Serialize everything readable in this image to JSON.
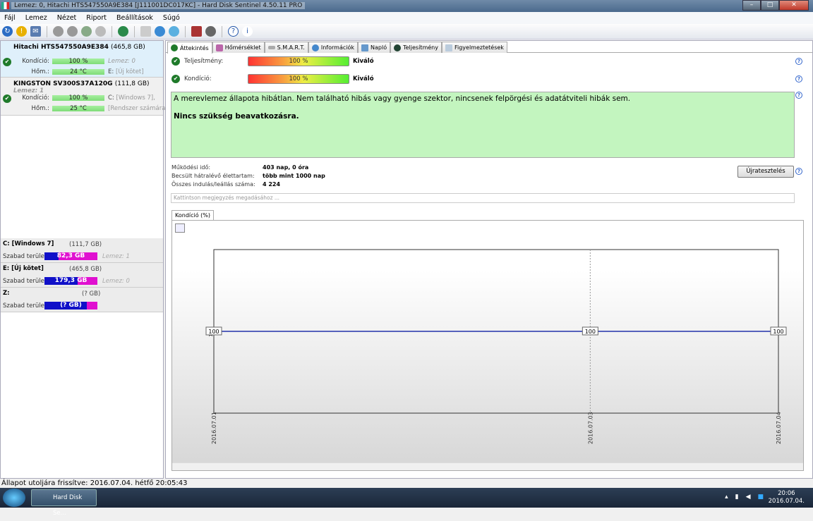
{
  "window": {
    "title": "Lemez: 0, Hitachi HTS547550A9E384 [J111001DC017KC]  -  Hard Disk Sentinel 4.50.11 PRO"
  },
  "menu": [
    "Fájl",
    "Lemez",
    "Nézet",
    "Riport",
    "Beállítások",
    "Súgó"
  ],
  "disks": [
    {
      "name": "Hitachi HTS547550A9E384",
      "size": "(465,8 GB)",
      "cond_label": "Kondíció:",
      "cond": "100 %",
      "temp_label": "Hőm.:",
      "temp": "24 °C",
      "extra1": "Lemez: 0",
      "extra2_drive": "E:",
      "extra2": "[Új kötet]"
    },
    {
      "name": "KINGSTON SV300S37A120G",
      "size": "(111,8 GB)",
      "disk_no": "Lemez: 1",
      "cond_label": "Kondíció:",
      "cond": "100 %",
      "temp_label": "Hőm.:",
      "temp": "25 °C",
      "extra1_drive": "C:",
      "extra1": "[Windows 7],",
      "extra2": "[Rendszer számára"
    }
  ],
  "volumes": [
    {
      "name": "C: [Windows 7]",
      "size": "(111,7 GB)",
      "free_label": "Szabad terület",
      "free": "82,3 GB",
      "used_fraction": 0.26,
      "disk": "Lemez: 1"
    },
    {
      "name": "E: [Új kötet]",
      "size": "(465,8 GB)",
      "free_label": "Szabad terület",
      "free": "179,3 GB",
      "used_fraction": 0.62,
      "disk": "Lemez: 0"
    },
    {
      "name": "Z:",
      "size": "(? GB)",
      "free_label": "Szabad terület",
      "free": "(? GB)",
      "used_fraction": 0.8,
      "disk": ""
    }
  ],
  "tabs": [
    "Áttekintés",
    "Hőmérséklet",
    "S.M.A.R.T.",
    "Információk",
    "Napló",
    "Teljesítmény",
    "Figyelmeztetések"
  ],
  "overview": {
    "perf_label": "Teljesítmény:",
    "perf": "100 %",
    "perf_rating": "Kiváló",
    "cond_label": "Kondíció:",
    "cond": "100 %",
    "cond_rating": "Kiváló",
    "message": "A merevlemez állapota hibátlan. Nem található hibás vagy gyenge szektor, nincsenek felpörgési és adatátviteli hibák sem.",
    "message2": "Nincs szükség beavatkozásra.",
    "uptime_label": "Működési idő:",
    "uptime": "403 nap, 0 óra",
    "life_label": "Becsült hátralévő élettartam:",
    "life": "több mint 1000 nap",
    "starts_label": "Összes indulás/leállás száma:",
    "starts": "4 224",
    "retest": "Újratesztelés",
    "note_placeholder": "Kattintson megjegyzés megadásához ...",
    "chart_tab": "Kondíció  (%)"
  },
  "chart_data": {
    "type": "line",
    "title": "Kondíció (%)",
    "x": [
      "2016.07.01",
      "2016.07.03",
      "2016.07.04"
    ],
    "x_days": [
      0,
      2,
      3
    ],
    "values": [
      100,
      100,
      100
    ],
    "ylabel": "100",
    "ylim": [
      0,
      200
    ],
    "series_color": "#2233aa"
  },
  "status": "Állapot utoljára frissítve: 2016.07.04. hétfő 20:05:43",
  "taskbar": {
    "app": "Hard Disk Se...",
    "time": "20:06",
    "date": "2016.07.04."
  }
}
